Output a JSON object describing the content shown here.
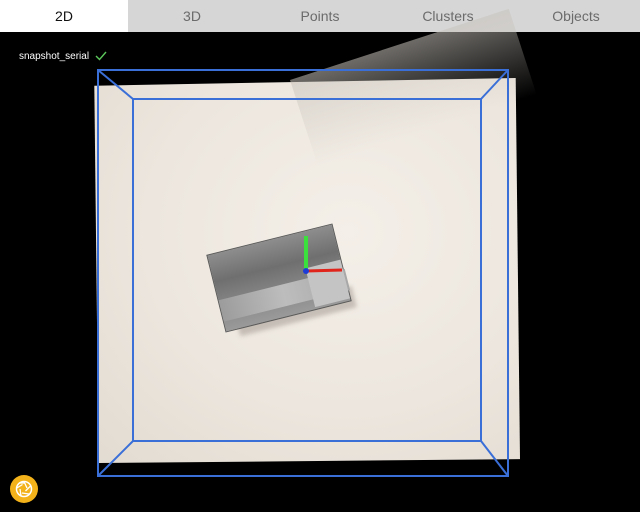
{
  "tabs": [
    {
      "label": "2D",
      "active": true
    },
    {
      "label": "3D",
      "active": false
    },
    {
      "label": "Points",
      "active": false
    },
    {
      "label": "Clusters",
      "active": false
    },
    {
      "label": "Objects",
      "active": false
    }
  ],
  "viewport": {
    "snapshot_label": "snapshot_serial",
    "snapshot_status_icon": "check-icon",
    "bounding_box_color": "#3a6fd8",
    "axis_colors": {
      "x": "#e0241b",
      "y": "#3ce03c",
      "z": "#1e3bd8"
    }
  },
  "shutter": {
    "icon": "aperture-icon",
    "color": "#f3b21a"
  }
}
